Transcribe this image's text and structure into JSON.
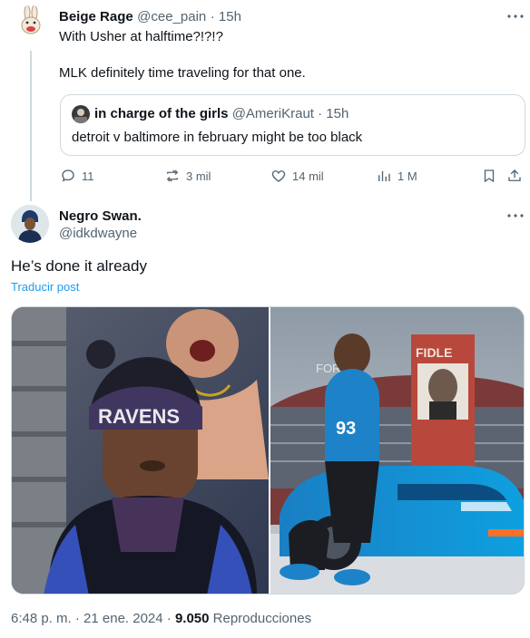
{
  "tweet1": {
    "display_name": "Beige Rage",
    "handle": "@cee_pain",
    "time": "· 15h",
    "line1": "With Usher at halftime?!?!?",
    "line2": "MLK definitely time traveling for that one.",
    "quote": {
      "display_name": "in charge of the girls",
      "handle": "@AmeriKraut",
      "time": "· 15h",
      "text": "detroit v baltimore in february might be too black"
    },
    "actions": {
      "replies": "11",
      "reposts": "3 mil",
      "likes": "14 mil",
      "views": "1 M"
    }
  },
  "tweet2": {
    "display_name": "Negro Swan.",
    "handle": "@idkdwayne",
    "text": "He’s done it already",
    "translate": "Traducir post",
    "media": {
      "left_caption": "RAVENS",
      "right_sign": "FIDLE",
      "right_building": "FORD",
      "jersey_number": "93"
    },
    "timestamp": "6:48 p. m. · 21 ene. 2024 · ",
    "views_count": "9.050",
    "views_label": " Reproducciones"
  },
  "icons": [
    "more-icon",
    "reply-icon",
    "repost-icon",
    "like-icon",
    "views-icon",
    "bookmark-icon",
    "share-icon"
  ]
}
